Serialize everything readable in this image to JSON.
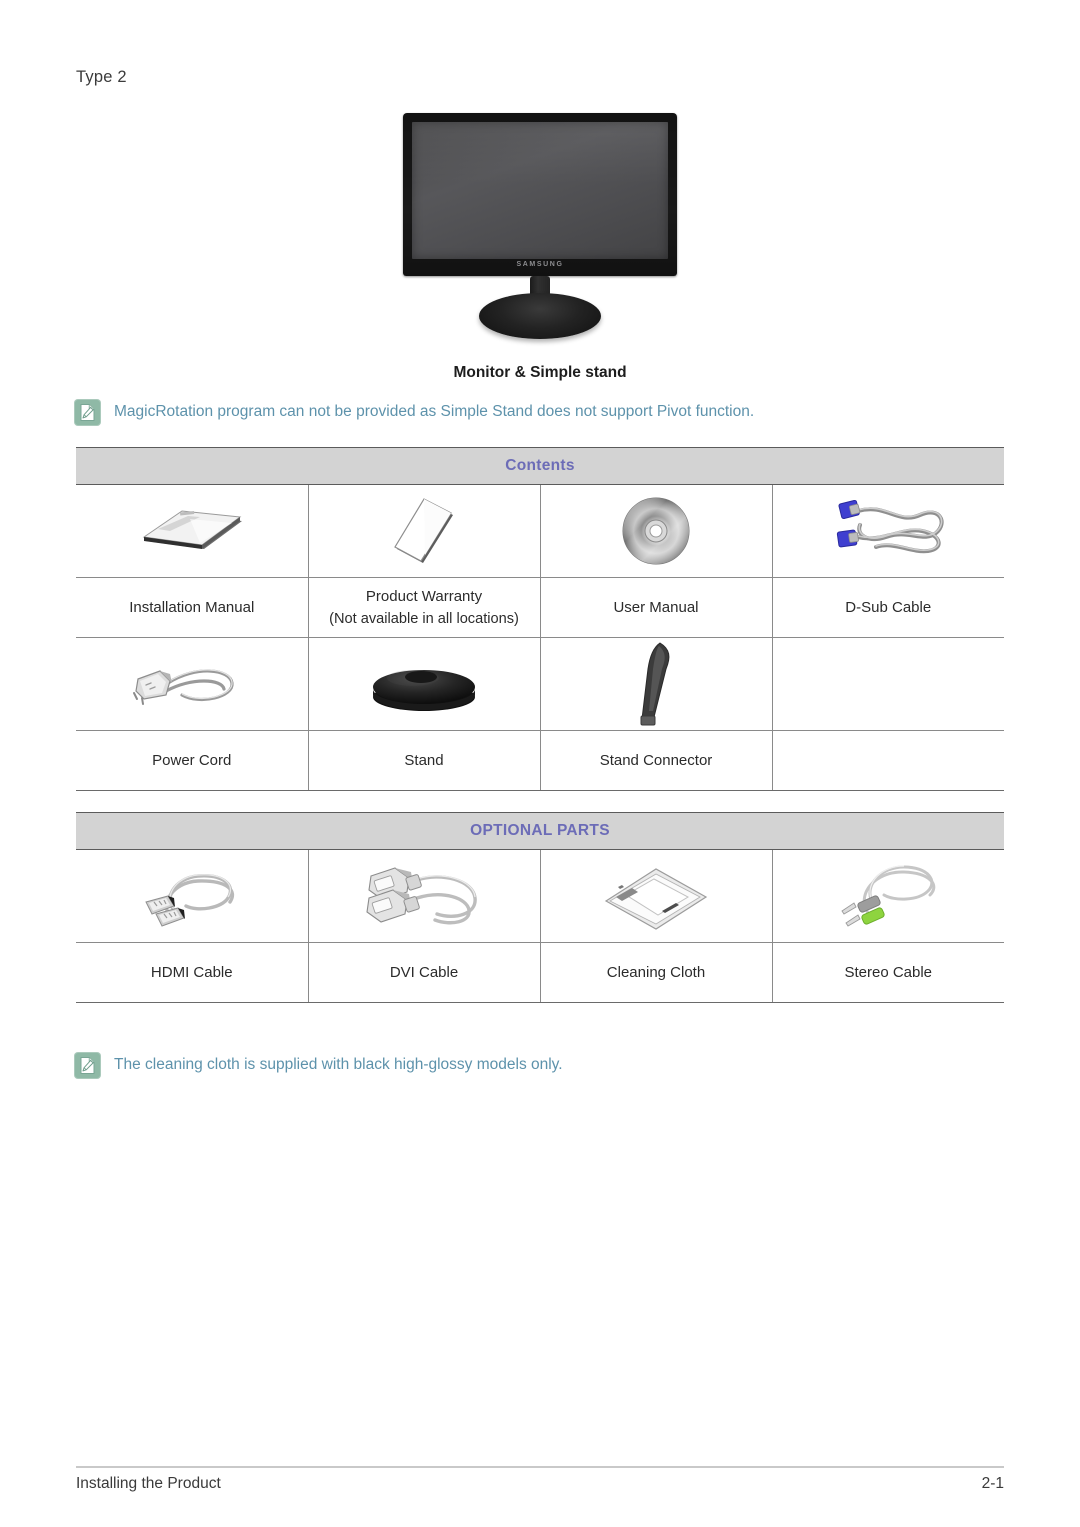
{
  "page": {
    "type_label": "Type 2",
    "hero_caption": "Monitor & Simple stand",
    "hero_brand": "SAMSUNG"
  },
  "notes": {
    "top": {
      "icon": "note-pencil-icon",
      "text": "MagicRotation program can not be provided as Simple Stand does not support Pivot function."
    },
    "bottom": {
      "icon": "note-pencil-icon",
      "text": "The cleaning cloth is supplied with black high-glossy models only."
    }
  },
  "tables": [
    {
      "id": "contents",
      "header": "Contents",
      "rows": [
        [
          {
            "icon": "installation-manual-icon",
            "label": "Installation Manual",
            "sub": ""
          },
          {
            "icon": "product-warranty-icon",
            "label": "Product Warranty",
            "sub": "(Not available in all locations)"
          },
          {
            "icon": "user-manual-cd-icon",
            "label": "User Manual",
            "sub": ""
          },
          {
            "icon": "d-sub-cable-icon",
            "label": "D-Sub Cable",
            "sub": ""
          }
        ],
        [
          {
            "icon": "power-cord-icon",
            "label": "Power Cord",
            "sub": ""
          },
          {
            "icon": "stand-base-icon",
            "label": "Stand",
            "sub": ""
          },
          {
            "icon": "stand-connector-icon",
            "label": "Stand Connector",
            "sub": ""
          },
          {
            "icon": "",
            "label": "",
            "sub": ""
          }
        ]
      ]
    },
    {
      "id": "optional",
      "header": "OPTIONAL PARTS",
      "rows": [
        [
          {
            "icon": "hdmi-cable-icon",
            "label": "HDMI Cable",
            "sub": ""
          },
          {
            "icon": "dvi-cable-icon",
            "label": "DVI Cable",
            "sub": ""
          },
          {
            "icon": "cleaning-cloth-icon",
            "label": "Cleaning Cloth",
            "sub": ""
          },
          {
            "icon": "stereo-cable-icon",
            "label": "Stereo Cable",
            "sub": ""
          }
        ]
      ]
    }
  ],
  "footer": {
    "left": "Installing the Product",
    "right": "2-1"
  },
  "colors": {
    "section_header_bg": "#d3d3d3",
    "section_header_text": "#6c6cb7",
    "note_text": "#5d92ab",
    "note_icon_bg": "#8fb9a6",
    "table_border": "#8a8a8a",
    "body_text": "#2b2b2b"
  }
}
